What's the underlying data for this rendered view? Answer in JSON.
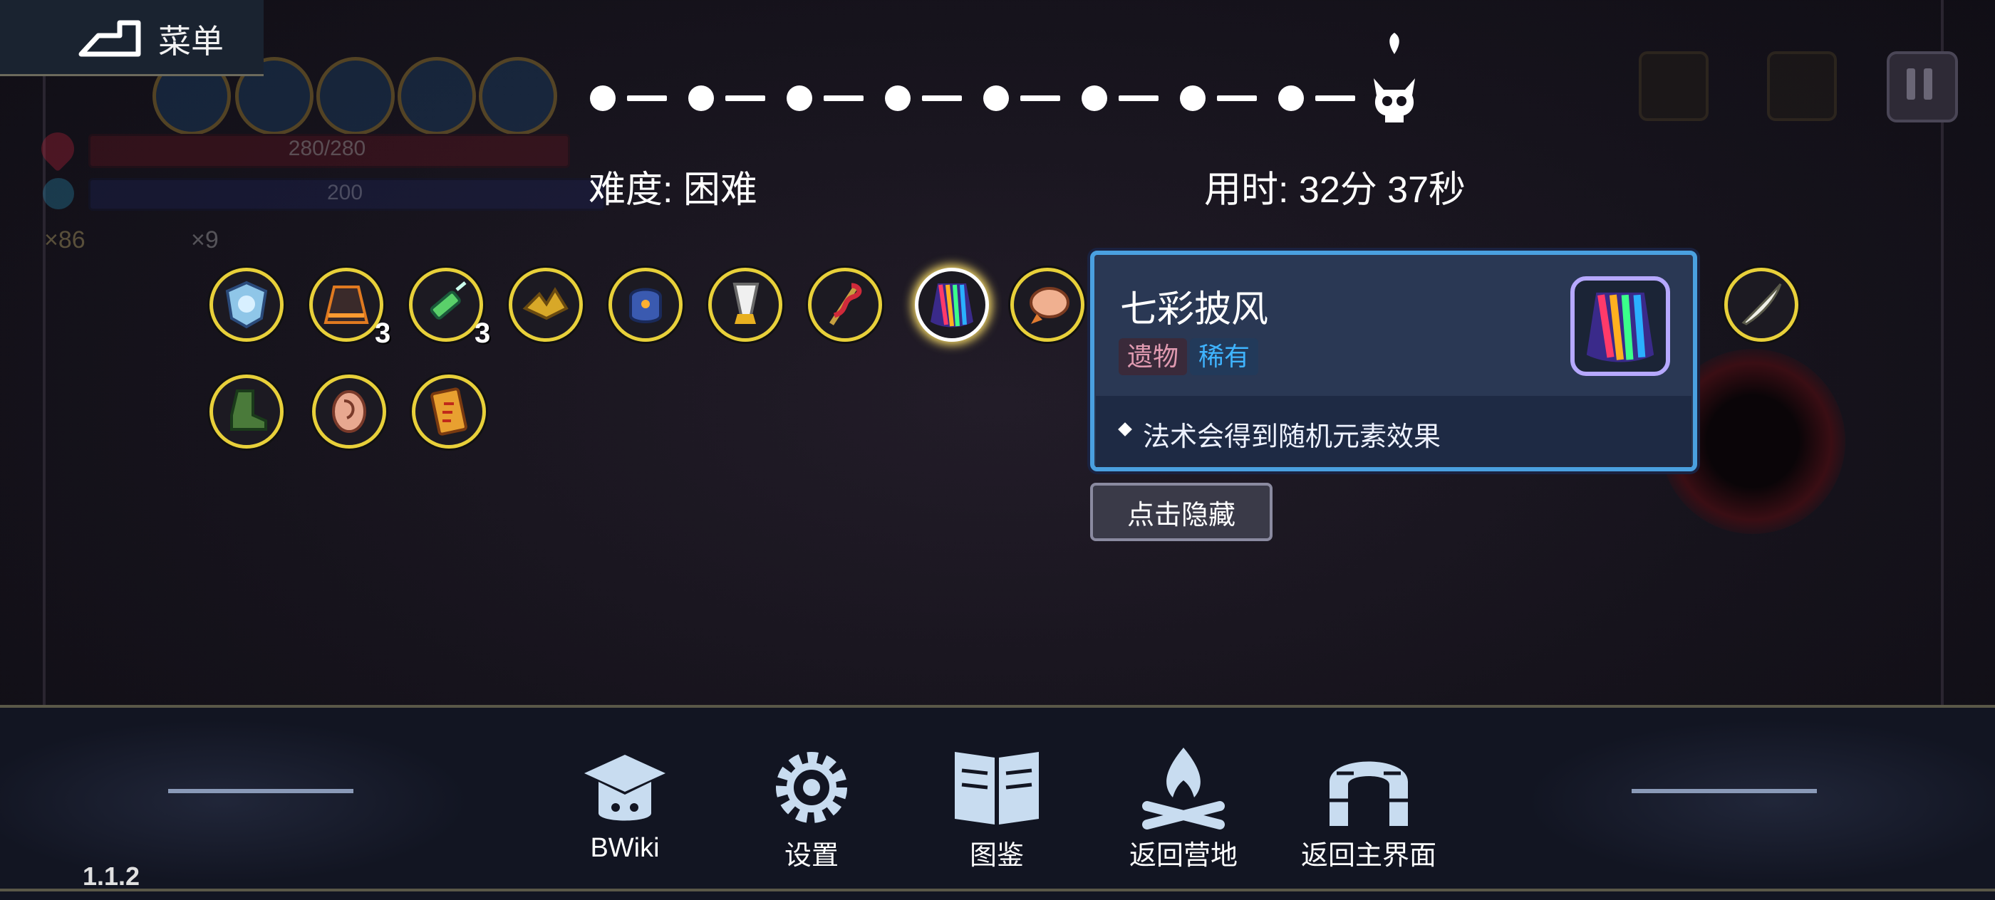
{
  "header": {
    "menu_label": "菜单"
  },
  "hud": {
    "hp": "280/280",
    "mp": "200",
    "coins": "×86",
    "keys": "×9"
  },
  "progress": {
    "nodes_cleared": 8
  },
  "run_info": {
    "difficulty": "难度: 困难",
    "time": "用时: 32分 37秒"
  },
  "inventory": {
    "row1": [
      {
        "icon": "ghost-shield-icon",
        "count": ""
      },
      {
        "icon": "lava-skirt-icon",
        "count": "3"
      },
      {
        "icon": "green-syringe-icon",
        "count": "3"
      },
      {
        "icon": "golden-feather-crown-icon",
        "count": ""
      },
      {
        "icon": "blue-gauntlet-icon",
        "count": ""
      },
      {
        "icon": "drill-horn-icon",
        "count": ""
      },
      {
        "icon": "snake-staff-icon",
        "count": ""
      },
      {
        "icon": "rainbow-cape-icon",
        "count": ""
      },
      {
        "icon": "fist-creature-icon",
        "count": ""
      }
    ],
    "row2": [
      {
        "icon": "green-boot-icon",
        "count": ""
      },
      {
        "icon": "ear-icon",
        "count": ""
      },
      {
        "icon": "fire-scroll-icon",
        "count": ""
      }
    ],
    "extra_item": {
      "icon": "bone-feather-icon"
    }
  },
  "tooltip": {
    "name": "七彩披风",
    "tag_type": "遗物",
    "tag_rarity": "稀有",
    "description": "法术会得到随机元素效果",
    "hide_button": "点击隐藏"
  },
  "bottom_menu": {
    "items": [
      {
        "label": "BWiki",
        "icon": "graduation-cap-icon"
      },
      {
        "label": "设置",
        "icon": "gear-icon"
      },
      {
        "label": "图鉴",
        "icon": "book-icon"
      },
      {
        "label": "返回营地",
        "icon": "campfire-icon"
      },
      {
        "label": "返回主界面",
        "icon": "stone-arch-icon"
      }
    ]
  },
  "version": "1.1.2",
  "colors": {
    "accent_yellow": "#e8d03a",
    "tooltip_border": "#4aa0e0",
    "rarity_blue": "#3fb4ff",
    "type_pink": "#e09ab0"
  }
}
